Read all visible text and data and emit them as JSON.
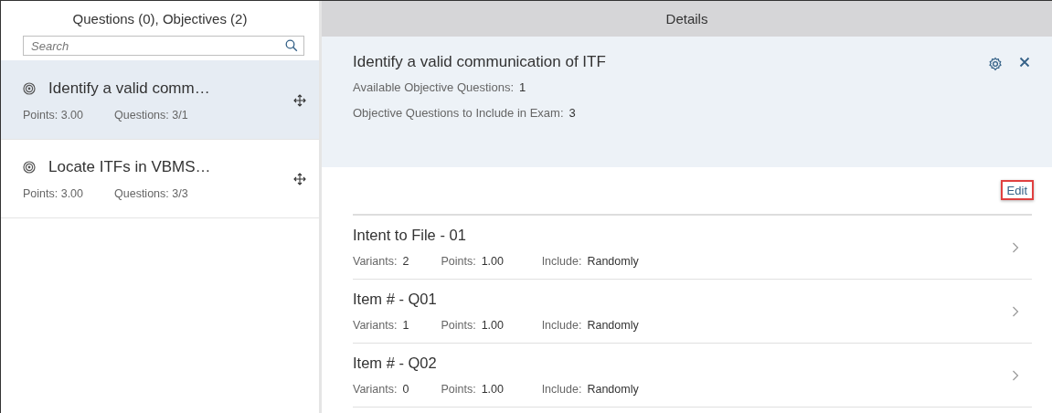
{
  "left_panel": {
    "title": "Questions (0), Objectives (2)",
    "search": {
      "placeholder": "Search"
    },
    "objectives": [
      {
        "title": "Identify a valid comm…",
        "points_label": "Points: 3.00",
        "questions_label": "Questions: 3/1",
        "selected": true
      },
      {
        "title": "Locate ITFs in VBMS…",
        "points_label": "Points: 3.00",
        "questions_label": "Questions: 3/3",
        "selected": false
      }
    ]
  },
  "details": {
    "title": "Details",
    "objective_title": "Identify a valid communication of ITF",
    "fields": [
      {
        "label": "Available Objective Questions:",
        "value": "1"
      },
      {
        "label": "Objective Questions to Include in Exam:",
        "value": "3"
      }
    ],
    "edit_button": {
      "label": "Edit",
      "highlighted": true
    },
    "questions": [
      {
        "title": "Intent to File - 01",
        "variants_label": "Variants:",
        "variants": "2",
        "points_label": "Points:",
        "points": "1.00",
        "include_label": "Include:",
        "include": "Randomly"
      },
      {
        "title": "Item # - Q01",
        "variants_label": "Variants:",
        "variants": "1",
        "points_label": "Points:",
        "points": "1.00",
        "include_label": "Include:",
        "include": "Randomly"
      },
      {
        "title": "Item # - Q02",
        "variants_label": "Variants:",
        "variants": "0",
        "points_label": "Points:",
        "points": "1.00",
        "include_label": "Include:",
        "include": "Randomly"
      }
    ]
  }
}
